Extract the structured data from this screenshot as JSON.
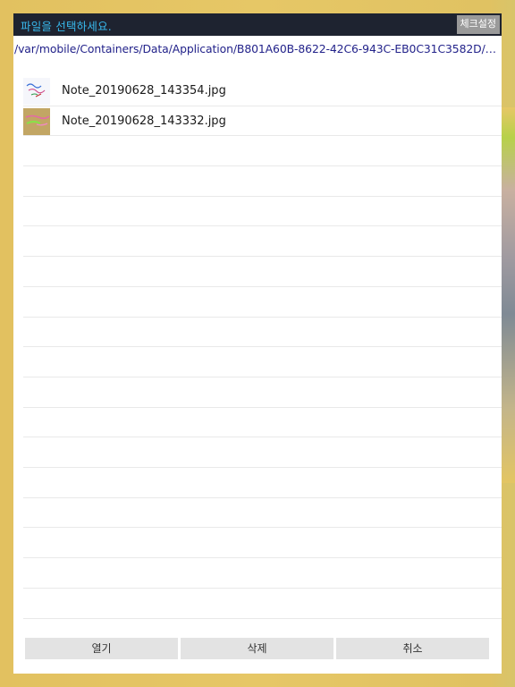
{
  "title_bar": {
    "title": "파일을 선택하세요.",
    "check_settings_label": "체크설정"
  },
  "path": "/var/mobile/Containers/Data/Application/B801A60B-8622-42C6-943C-EB0C31C3582D/Doc...",
  "files": [
    {
      "name": "Note_20190628_143354.jpg",
      "thumbnail_icon": "image-thumbnail-icon"
    },
    {
      "name": "Note_20190628_143332.jpg",
      "thumbnail_icon": "image-thumbnail-icon"
    }
  ],
  "buttons": {
    "open_label": "열기",
    "delete_label": "삭제",
    "cancel_label": "취소"
  },
  "colors": {
    "title_bar_bg": "#1e2330",
    "title_text": "#38b8ec",
    "path_text": "#22228a",
    "button_bg": "#e3e3e3",
    "background": "#e2c160"
  }
}
